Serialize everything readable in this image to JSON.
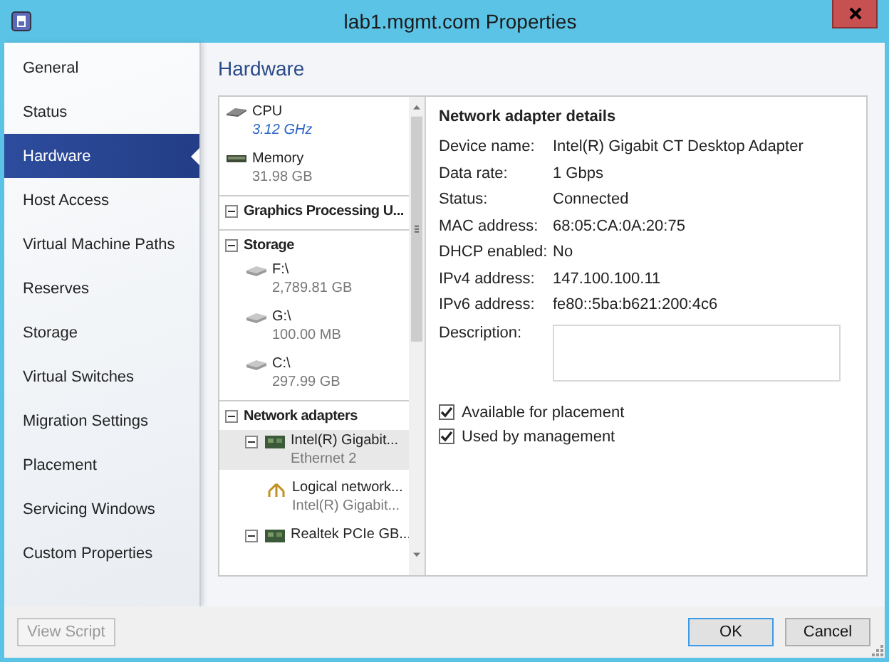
{
  "window": {
    "title": "lab1.mgmt.com Properties"
  },
  "sidebar": {
    "items": [
      {
        "label": "General",
        "selected": false
      },
      {
        "label": "Status",
        "selected": false
      },
      {
        "label": "Hardware",
        "selected": true
      },
      {
        "label": "Host Access",
        "selected": false
      },
      {
        "label": "Virtual Machine Paths",
        "selected": false
      },
      {
        "label": "Reserves",
        "selected": false
      },
      {
        "label": "Storage",
        "selected": false
      },
      {
        "label": "Virtual Switches",
        "selected": false
      },
      {
        "label": "Migration Settings",
        "selected": false
      },
      {
        "label": "Placement",
        "selected": false
      },
      {
        "label": "Servicing Windows",
        "selected": false
      },
      {
        "label": "Custom Properties",
        "selected": false
      }
    ]
  },
  "heading": "Hardware",
  "hardware_tree": [
    {
      "kind": "cpu",
      "name": "CPU",
      "detail": "3.12 GHz",
      "selected": false
    },
    {
      "kind": "memory",
      "name": "Memory",
      "detail": "31.98 GB",
      "selected": false
    },
    {
      "kind": "group",
      "name": "Graphics Processing U...",
      "expanded": true
    },
    {
      "kind": "group",
      "name": "Storage",
      "expanded": true,
      "children": [
        {
          "kind": "disk",
          "name": "F:\\",
          "detail": "2,789.81 GB",
          "selected": false
        },
        {
          "kind": "disk",
          "name": "G:\\",
          "detail": "100.00 MB",
          "selected": false
        },
        {
          "kind": "disk",
          "name": "C:\\",
          "detail": "297.99 GB",
          "selected": false
        }
      ]
    },
    {
      "kind": "group",
      "name": "Network adapters",
      "expanded": true,
      "children": [
        {
          "kind": "adapter",
          "name": "Intel(R) Gigabit...",
          "detail": "Ethernet 2",
          "expanded": true,
          "selected": true,
          "children": [
            {
              "kind": "network",
              "name": "Logical network...",
              "detail": "Intel(R) Gigabit...",
              "selected": false
            }
          ]
        },
        {
          "kind": "adapter",
          "name": "Realtek PCIe GB...",
          "expanded": true,
          "selected": false
        }
      ]
    }
  ],
  "details": {
    "title": "Network adapter details",
    "fields": [
      {
        "label": "Device name:",
        "value": "Intel(R) Gigabit CT Desktop Adapter"
      },
      {
        "label": "Data rate:",
        "value": "1 Gbps"
      },
      {
        "label": "Status:",
        "value": "Connected"
      },
      {
        "label": "MAC address:",
        "value": "68:05:CA:0A:20:75"
      },
      {
        "label": "DHCP enabled:",
        "value": "No"
      },
      {
        "label": "IPv4 address:",
        "value": "147.100.100.11"
      },
      {
        "label": "IPv6 address:",
        "value": "fe80::5ba:b621:200:4c6"
      }
    ],
    "description": {
      "label": "Description:"
    },
    "checkboxes": [
      {
        "label": "Available for placement",
        "checked": true
      },
      {
        "label": "Used by management",
        "checked": true
      }
    ]
  },
  "footer": {
    "buttons": [
      {
        "label": "View Script",
        "disabled": true,
        "default": false
      },
      {
        "label": "OK",
        "disabled": false,
        "default": true
      },
      {
        "label": "Cancel",
        "disabled": false,
        "default": false
      }
    ]
  }
}
